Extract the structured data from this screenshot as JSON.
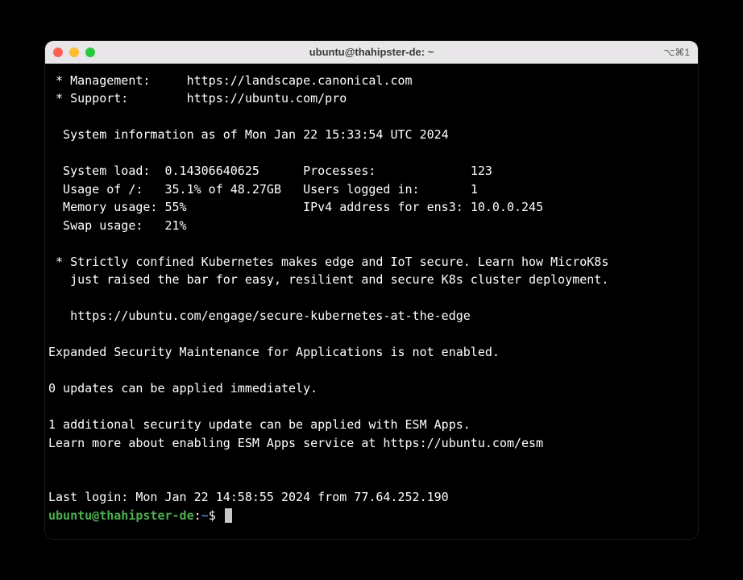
{
  "window": {
    "title": "ubuntu@thahipster-de: ~",
    "shortcut": "⌥⌘1"
  },
  "motd": {
    "management_label": " * Management:",
    "management_url": "https://landscape.canonical.com",
    "support_label": " * Support:",
    "support_url": "https://ubuntu.com/pro",
    "sysinfo_header": "  System information as of Mon Jan 22 15:33:54 UTC 2024",
    "stats": {
      "system_load_label": "  System load:",
      "system_load_value": "0.14306640625",
      "processes_label": "Processes:",
      "processes_value": "123",
      "usage_label": "  Usage of /:",
      "usage_value": "35.1% of 48.27GB",
      "users_label": "Users logged in:",
      "users_value": "1",
      "memory_label": "  Memory usage:",
      "memory_value": "55%",
      "ipv4_label": "IPv4 address for ens3:",
      "ipv4_value": "10.0.0.245",
      "swap_label": "  Swap usage:",
      "swap_value": "21%"
    },
    "k8s_line1": " * Strictly confined Kubernetes makes edge and IoT secure. Learn how MicroK8s",
    "k8s_line2": "   just raised the bar for easy, resilient and secure K8s cluster deployment.",
    "k8s_url": "   https://ubuntu.com/engage/secure-kubernetes-at-the-edge",
    "esm_notice": "Expanded Security Maintenance for Applications is not enabled.",
    "updates": "0 updates can be applied immediately.",
    "esm_update1": "1 additional security update can be applied with ESM Apps.",
    "esm_update2": "Learn more about enabling ESM Apps service at https://ubuntu.com/esm",
    "last_login": "Last login: Mon Jan 22 14:58:55 2024 from 77.64.252.190"
  },
  "prompt": {
    "user_host": "ubuntu@thahipster-de",
    "sep1": ":",
    "path": "~",
    "sep2": "$ "
  }
}
